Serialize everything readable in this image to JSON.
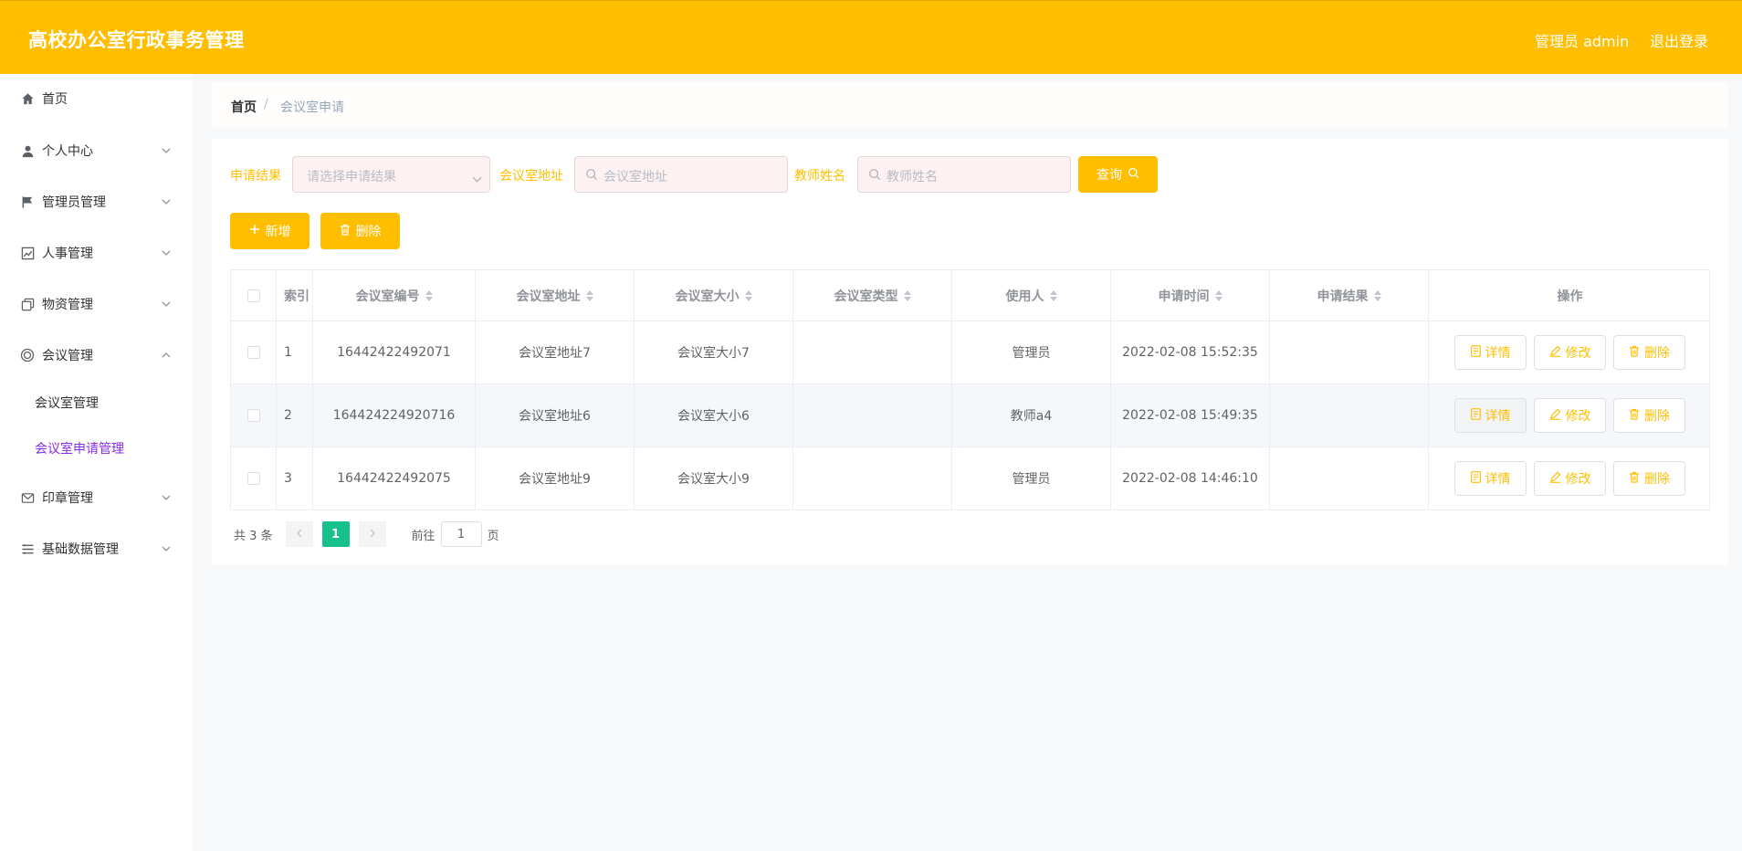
{
  "header": {
    "title": "高校办公室行政事务管理",
    "user": "管理员 admin",
    "logout": "退出登录"
  },
  "sidebar": {
    "items": [
      {
        "label": "首页",
        "icon": "home-icon"
      },
      {
        "label": "个人中心",
        "icon": "user-icon"
      },
      {
        "label": "管理员管理",
        "icon": "flag-icon"
      },
      {
        "label": "人事管理",
        "icon": "chart-icon"
      },
      {
        "label": "物资管理",
        "icon": "copy-icon"
      },
      {
        "label": "会议管理",
        "icon": "circle-icon"
      },
      {
        "label": "印章管理",
        "icon": "mail-icon"
      },
      {
        "label": "基础数据管理",
        "icon": "list-icon"
      }
    ],
    "sub": [
      {
        "label": "会议室管理"
      },
      {
        "label": "会议室申请管理"
      }
    ]
  },
  "breadcrumb": {
    "home": "首页",
    "sep": "/",
    "current": "会议室申请"
  },
  "filters": {
    "result_label": "申请结果",
    "result_placeholder": "请选择申请结果",
    "addr_label": "会议室地址",
    "addr_placeholder": "会议室地址",
    "teacher_label": "教师姓名",
    "teacher_placeholder": "教师姓名",
    "query": "查询"
  },
  "toolbar": {
    "add": "新增",
    "delete": "删除"
  },
  "table": {
    "headers": [
      "索引",
      "会议室编号",
      "会议室地址",
      "会议室大小",
      "会议室类型",
      "使用人",
      "申请时间",
      "申请结果",
      "操作"
    ],
    "rows": [
      {
        "idx": "1",
        "code": "16442422492071",
        "addr": "会议室地址7",
        "size": "会议室大小7",
        "type": "",
        "user": "管理员",
        "time": "2022-02-08 15:52:35",
        "result": ""
      },
      {
        "idx": "2",
        "code": "164424224920716",
        "addr": "会议室地址6",
        "size": "会议室大小6",
        "type": "",
        "user": "教师a4",
        "time": "2022-02-08 15:49:35",
        "result": ""
      },
      {
        "idx": "3",
        "code": "16442422492075",
        "addr": "会议室地址9",
        "size": "会议室大小9",
        "type": "",
        "user": "管理员",
        "time": "2022-02-08 14:46:10",
        "result": ""
      }
    ],
    "actions": {
      "detail": "详情",
      "edit": "修改",
      "delete": "删除"
    }
  },
  "pager": {
    "total": "共 3 条",
    "page": "1",
    "goto": "前往",
    "goto_value": "1",
    "page_unit": "页"
  },
  "colors": {
    "brand": "#ffbf00",
    "active_page": "#17c18b",
    "active_menu": "#8a2be2"
  }
}
